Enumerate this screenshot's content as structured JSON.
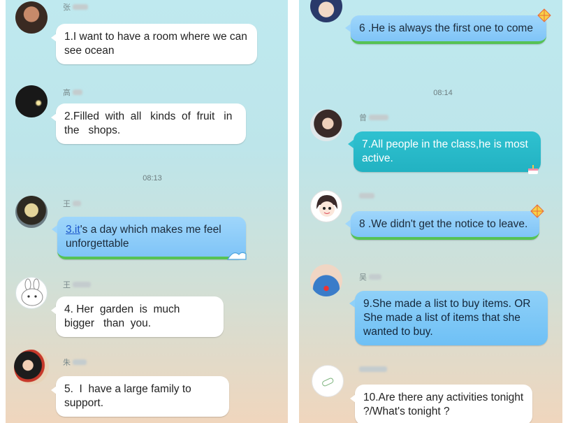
{
  "left_messages": [
    {
      "name": "张",
      "text": "1.I want to have a room where we can see ocean"
    },
    {
      "name": "高",
      "text": "2.Filled  with  all   kinds  of  fruit   in   the   shops."
    },
    {
      "name": "王",
      "link": "3.it",
      "text": "'s a day which makes me feel unforgettable"
    },
    {
      "name": "王",
      "text": "4. Her  garden  is  much  bigger   than  you."
    },
    {
      "name": "朱",
      "text": "5.  I  have a large family to support."
    }
  ],
  "left_time": "08:13",
  "right_messages": [
    {
      "name": "",
      "text": "6 .He is always the first one to come"
    },
    {
      "name": "曾",
      "text": "7.All people in the class,he is most active."
    },
    {
      "name": "",
      "text": "8 .We didn't get the notice to leave."
    },
    {
      "name": "吴",
      "text": "9.She made a list to buy items.  OR She made a list of items that she wanted to buy."
    },
    {
      "name": "",
      "text": "10.Are there any activities tonight ?/What's tonight ?"
    }
  ],
  "right_time": "08:14",
  "colors": {
    "blue_bubble": "#5ab3f6",
    "teal_bubble": "#2fc1d0",
    "green_border": "#56c255"
  },
  "icons": [
    "kite-icon",
    "wave-icon",
    "cake-icon"
  ]
}
